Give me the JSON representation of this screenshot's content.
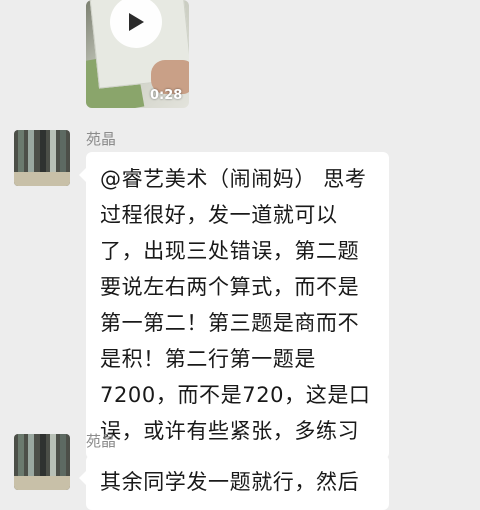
{
  "video": {
    "duration": "0:28",
    "play_icon": "play-icon"
  },
  "messages": [
    {
      "sender": "苑晶",
      "avatar": "avatar",
      "lines": [
        "@睿艺美术（闹闹妈） 思考",
        "过程很好，发一道就可以",
        "了，出现三处错误，第二题",
        "要说左右两个算式，而不是",
        "第一第二！第三题是商而不",
        "是积！第二行第一题是",
        "7200，而不是720，这是口",
        "误，或许有些紧张，多练习"
      ]
    },
    {
      "sender": "苑晶",
      "avatar": "avatar",
      "lines": [
        "其余同学发一题就行，然后"
      ]
    }
  ],
  "colors": {
    "background": "#ededed",
    "bubble": "#ffffff",
    "sender_name": "#8c8c8c",
    "text": "#191919"
  }
}
